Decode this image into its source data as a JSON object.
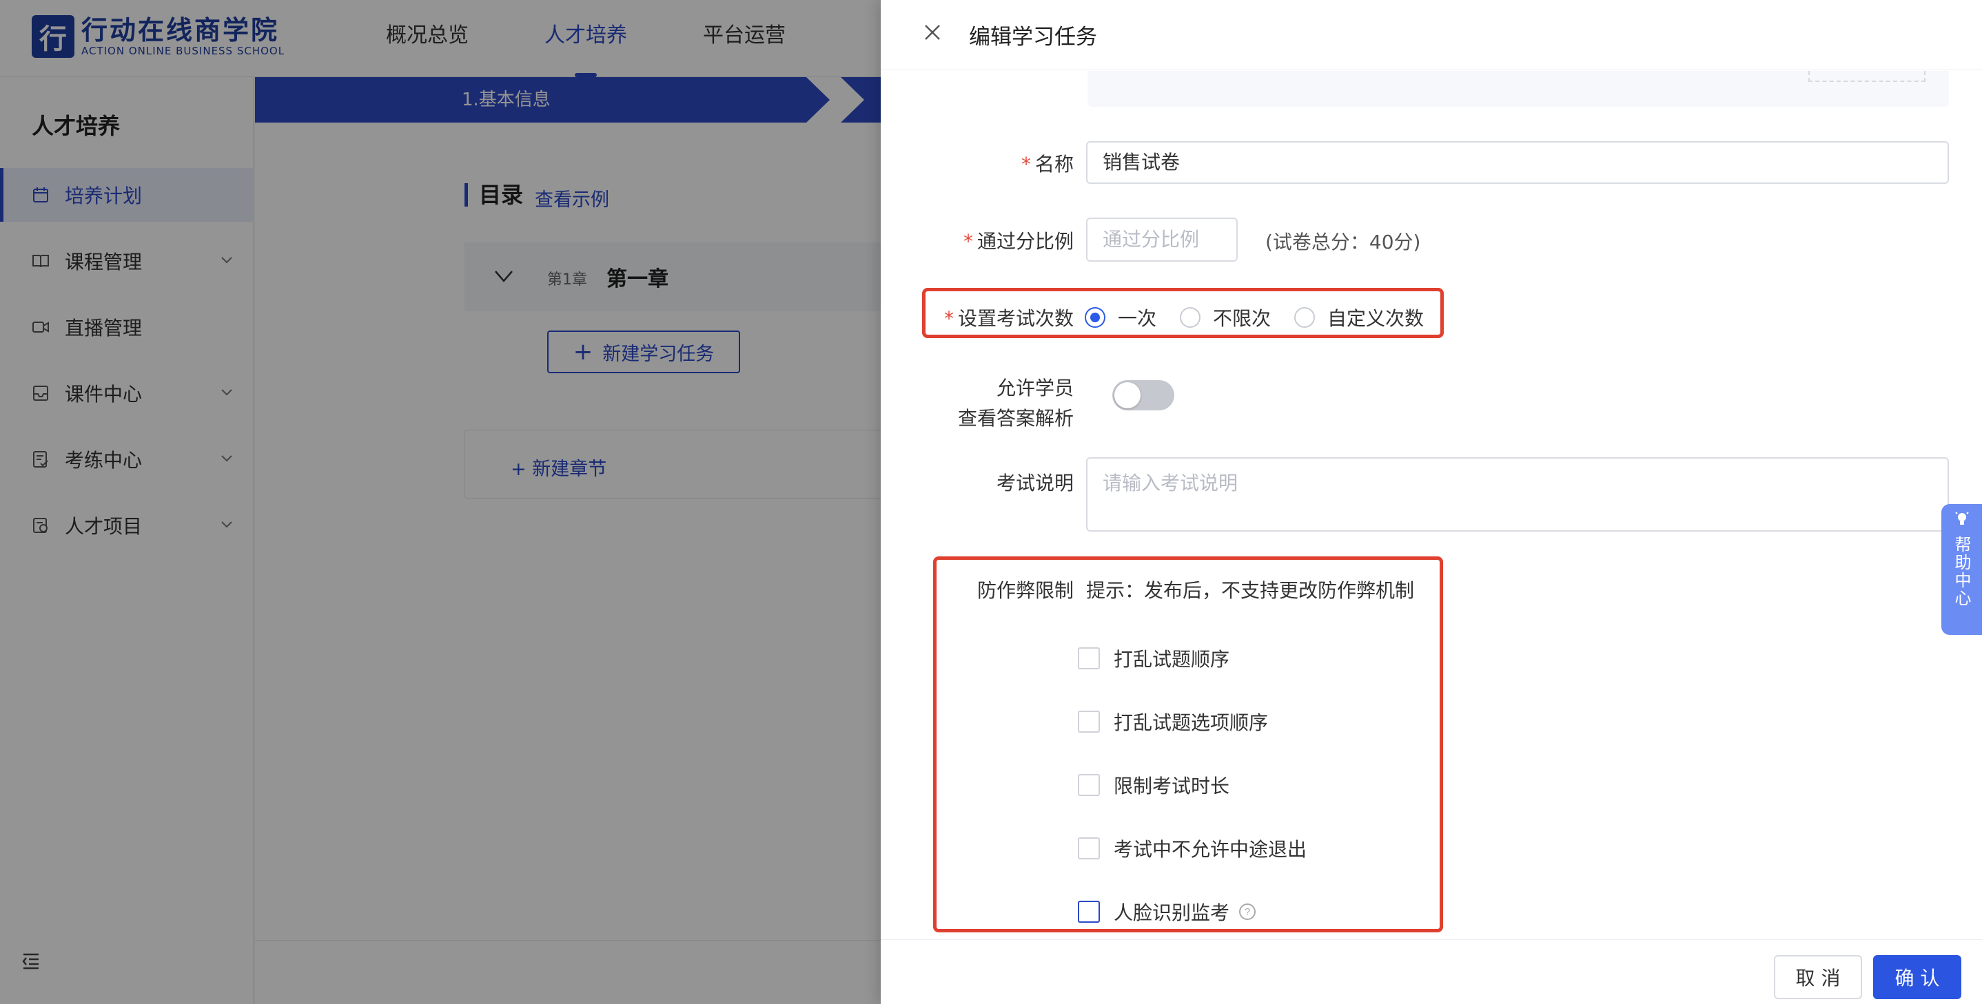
{
  "header": {
    "logo_mark": "行",
    "logo_cn": "行动在线商学院",
    "logo_en": "ACTION ONLINE BUSINESS SCHOOL",
    "nav": [
      {
        "label": "概况总览",
        "active": false
      },
      {
        "label": "人才培养",
        "active": true
      },
      {
        "label": "平台运营",
        "active": false
      }
    ]
  },
  "sidebar": {
    "title": "人才培养",
    "items": [
      {
        "label": "培养计划",
        "icon": "calendar-icon",
        "active": true,
        "expandable": false
      },
      {
        "label": "课程管理",
        "icon": "book-icon",
        "active": false,
        "expandable": true
      },
      {
        "label": "直播管理",
        "icon": "video-icon",
        "active": false,
        "expandable": false
      },
      {
        "label": "课件中心",
        "icon": "inbox-icon",
        "active": false,
        "expandable": true
      },
      {
        "label": "考练中心",
        "icon": "exam-icon",
        "active": false,
        "expandable": true
      },
      {
        "label": "人才项目",
        "icon": "project-icon",
        "active": false,
        "expandable": true
      }
    ]
  },
  "main": {
    "step1_label": "1.基本信息",
    "catalog_title": "目录",
    "catalog_link": "查看示例",
    "chapter_num": "第1章",
    "chapter_name": "第一章",
    "new_task_label": "新建学习任务",
    "new_section_label": "+ 新建章节"
  },
  "drawer": {
    "title": "编辑学习任务",
    "name_label": "名称",
    "name_value": "销售试卷",
    "pass_label": "通过分比例",
    "pass_placeholder": "通过分比例",
    "pass_hint": "(试卷总分：40分)",
    "attempts_label": "设置考试次数",
    "attempts_options": [
      {
        "label": "一次",
        "checked": true
      },
      {
        "label": "不限次",
        "checked": false
      },
      {
        "label": "自定义次数",
        "checked": false
      }
    ],
    "allow_label_line1": "允许学员",
    "allow_label_line2": "查看答案解析",
    "allow_enabled": false,
    "desc_label": "考试说明",
    "desc_placeholder": "请输入考试说明",
    "anticheat_label": "防作弊限制",
    "anticheat_hint": "提示：发布后，不支持更改防作弊机制",
    "anticheat_options": [
      {
        "label": "打乱试题顺序",
        "checked": false
      },
      {
        "label": "打乱试题选项顺序",
        "checked": false
      },
      {
        "label": "限制考试时长",
        "checked": false
      },
      {
        "label": "考试中不允许中途退出",
        "checked": false
      },
      {
        "label": "人脸识别监考",
        "checked": false
      }
    ],
    "cancel_label": "取 消",
    "confirm_label": "确 认"
  },
  "help": {
    "label": "帮助中心"
  },
  "colors": {
    "primary": "#2b49c8",
    "highlight": "#e0402f",
    "required": "#e34d3d"
  }
}
